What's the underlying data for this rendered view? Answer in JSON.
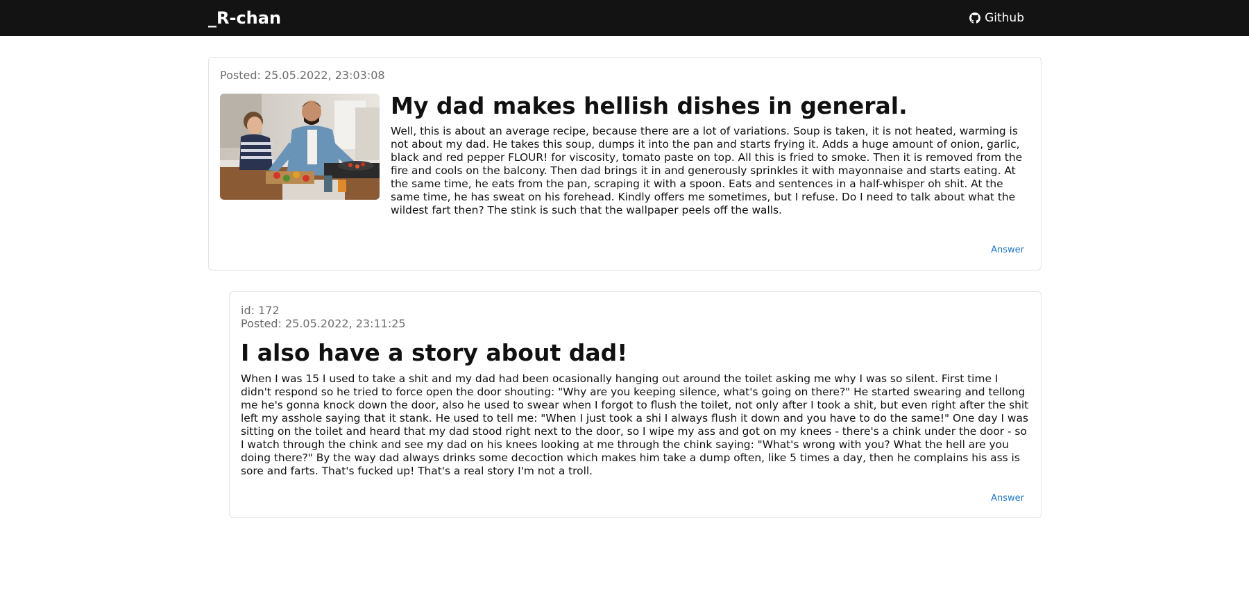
{
  "navbar": {
    "brand": "_R-chan",
    "github_label": "Github",
    "github_icon": "github-icon"
  },
  "posts": [
    {
      "posted": "Posted: 25.05.2022, 23:03:08",
      "image": "father-and-son-cooking",
      "title": "My dad makes hellish dishes in general.",
      "body": "Well, this is about an average recipe, because there are a lot of variations. Soup is taken, it is not heated, warming is not about my dad. He takes this soup, dumps it into the pan and starts frying it. Adds a huge amount of onion, garlic, black and red pepper FLOUR! for viscosity, tomato paste on top. All this is fried to smoke. Then it is removed from the fire and cools on the balcony. Then dad brings it in and generously sprinkles it with mayonnaise and starts eating. At the same time, he eats from the pan, scraping it with a spoon. Eats and sentences in a half-whisper oh shit. At the same time, he has sweat on his forehead. Kindly offers me sometimes, but I refuse. Do I need to talk about what the wildest fart then? The stink is such that the wallpaper peels off the walls.",
      "answer_label": "Answer"
    },
    {
      "id": "id: 172",
      "posted": "Posted: 25.05.2022, 23:11:25",
      "title": "I also have a story about dad!",
      "body": "When I was 15 I used to take a shit and my dad had been ocasionally hanging out around the toilet asking me why I was so silent. First time I didn't respond so he tried to force open the door shouting: \"Why are you keeping silence, what's going on there?\" He started swearing and tellong me he's gonna knock down the door, also he used to swear when I forgot to flush the toilet, not only after I took a shit, but even right after the shit left my asshole saying that it stank. He used to tell me: \"When I just took a shi I always flush it down and you have to do the same!\" One day I was sitting on the toilet and heard that my dad stood right next to the door, so I wipe my ass and got on my knees - there's a chink under the door - so I watch through the chink and see my dad on his knees looking at me through the chink saying: \"What's wrong with you? What the hell are you doing there?\" By the way dad always drinks some decoction which makes him take a dump often, like 5 times a day, then he complains his ass is sore and farts. That's fucked up! That's a real story I'm not a troll.",
      "answer_label": "Answer"
    }
  ],
  "colors": {
    "navbar_bg": "#131313",
    "link": "#1976d2",
    "meta_text": "#6c6c6c",
    "card_border": "#e2e2e2"
  }
}
